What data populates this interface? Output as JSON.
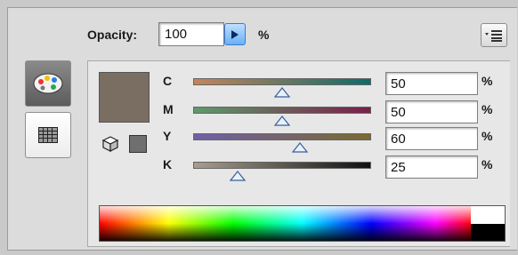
{
  "opacity": {
    "label": "Opacity:",
    "value": "100",
    "unit": "%"
  },
  "icons": {
    "opacity_arrow": "play-arrow-icon",
    "panel_menu": "panel-menu-icon",
    "color_tab": "color-palette-icon",
    "swatches_tab": "swatches-grid-icon",
    "gamut_warning": "3d-cube-icon"
  },
  "colors": {
    "fill": "#7a6d62",
    "gamut_swatch": "#6f6f6f",
    "accent": "#3a7bd5"
  },
  "channels": [
    {
      "label": "C",
      "value": "50",
      "unit": "%",
      "fraction": 0.5,
      "from": "#c4855a",
      "to": "#0f6b6b"
    },
    {
      "label": "M",
      "value": "50",
      "unit": "%",
      "fraction": 0.5,
      "from": "#5f9a6a",
      "to": "#7a1f4a"
    },
    {
      "label": "Y",
      "value": "60",
      "unit": "%",
      "fraction": 0.6,
      "from": "#6f5fa8",
      "to": "#7a6a30"
    },
    {
      "label": "K",
      "value": "25",
      "unit": "%",
      "fraction": 0.25,
      "from": "#a89e8f",
      "to": "#111111"
    }
  ]
}
